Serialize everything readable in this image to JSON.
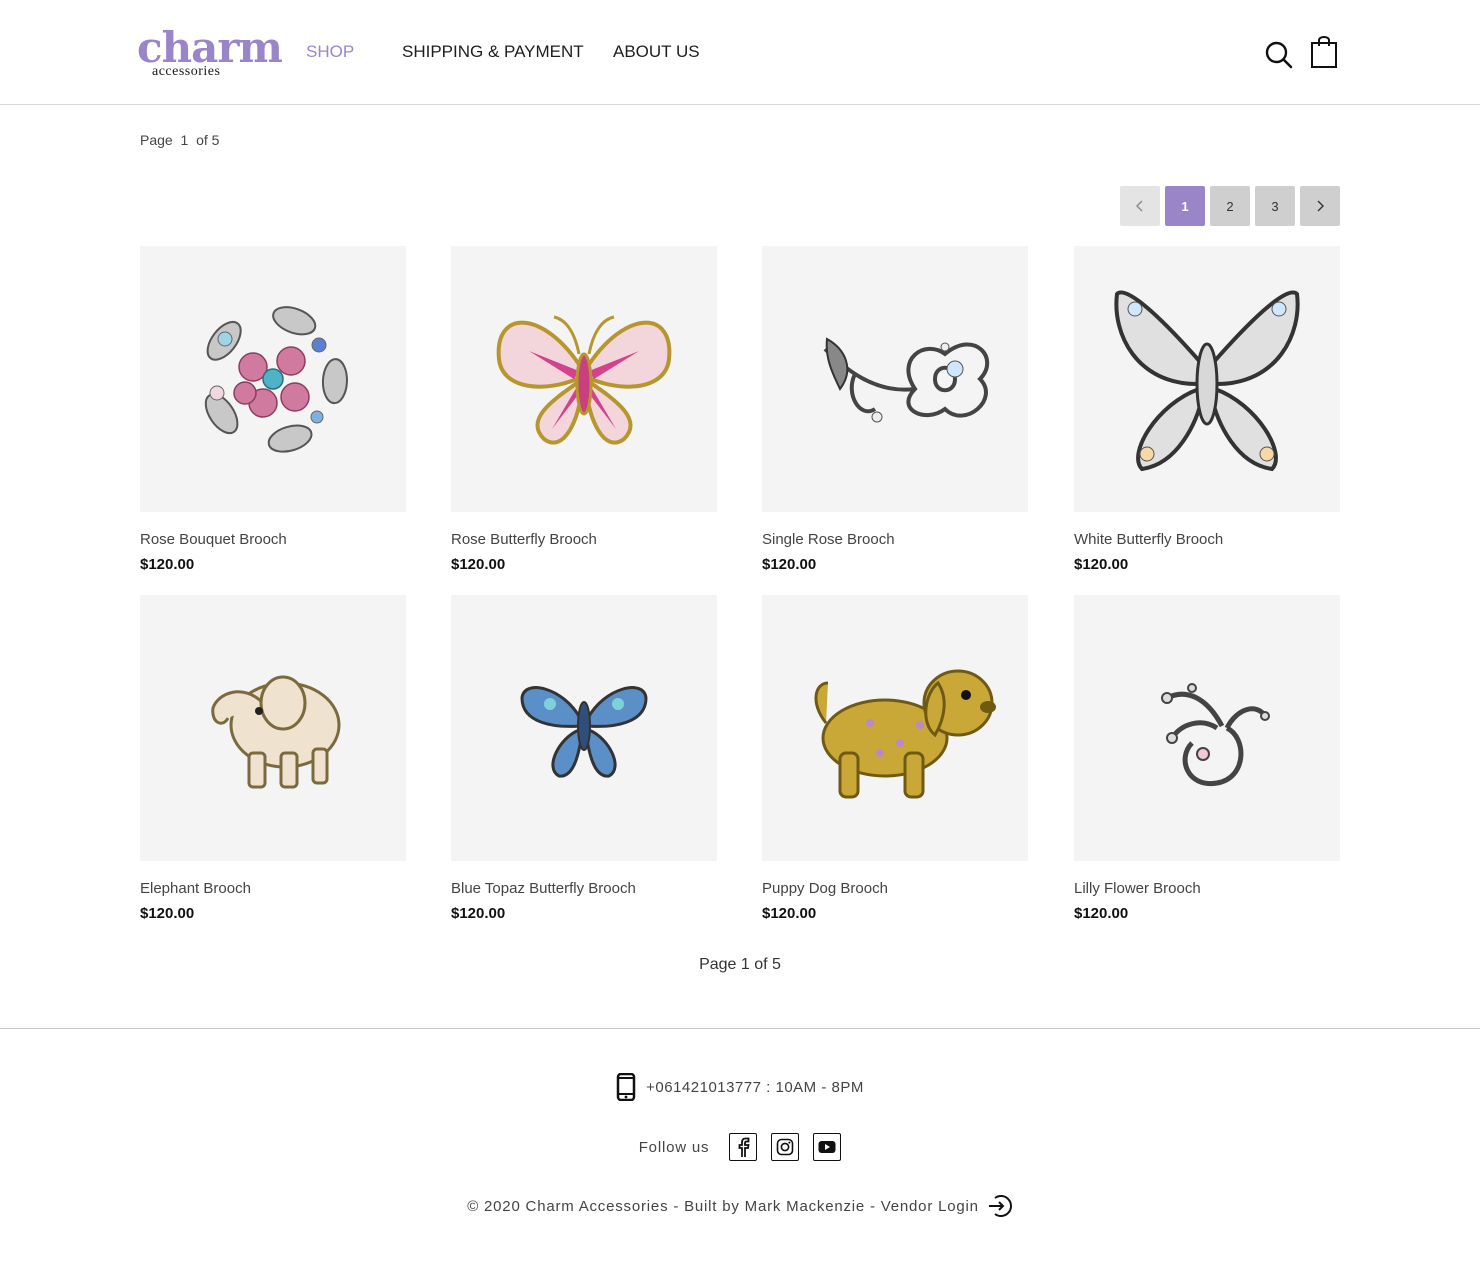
{
  "brand": {
    "name": "charm",
    "tagline": "accessories",
    "color": "#9b85c9"
  },
  "nav": {
    "items": [
      {
        "label": "SHOP",
        "active": true
      },
      {
        "label": "SHIPPING & PAYMENT",
        "active": false
      },
      {
        "label": "ABOUT US",
        "active": false
      }
    ],
    "icons": [
      "search-icon",
      "shopping-bag-icon"
    ]
  },
  "listing": {
    "page_word": "Page",
    "current_page": "1",
    "of_text": "of 5",
    "pagination": {
      "prev_icon": "chevron-left-icon",
      "pages": [
        "1",
        "2",
        "3"
      ],
      "active_page": "1",
      "next_icon": "chevron-right-icon"
    },
    "products": [
      {
        "name": "Rose Bouquet Brooch",
        "price": "$120.00"
      },
      {
        "name": "Rose Butterfly Brooch",
        "price": "$120.00"
      },
      {
        "name": "Single Rose Brooch",
        "price": "$120.00"
      },
      {
        "name": "White Butterfly Brooch",
        "price": "$120.00"
      },
      {
        "name": "Elephant Brooch",
        "price": "$120.00"
      },
      {
        "name": "Blue Topaz Butterfly Brooch",
        "price": "$120.00"
      },
      {
        "name": "Puppy Dog Brooch",
        "price": "$120.00"
      },
      {
        "name": "Lilly Flower Brooch",
        "price": "$120.00"
      }
    ],
    "bottom_label": "Page 1 of 5"
  },
  "footer": {
    "phone": "+061421013777 : 10AM - 8PM",
    "follow_label": "Follow us",
    "social": [
      "facebook-icon",
      "instagram-icon",
      "youtube-icon"
    ],
    "copyright": "© 2020 Charm Accessories - Built by Mark Mackenzie - Vendor Login"
  }
}
